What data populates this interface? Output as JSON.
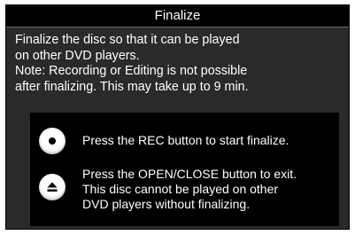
{
  "dialog": {
    "title": "Finalize",
    "description_lines": [
      "Finalize the disc so that it can be played",
      "on other DVD players.",
      "Note: Recording or Editing is not possible",
      "after finalizing. This may take up to 9 min."
    ]
  },
  "instructions": [
    {
      "icon": "rec-button-icon",
      "lines": [
        "Press the REC button to start finalize."
      ]
    },
    {
      "icon": "eject-button-icon",
      "lines": [
        "Press the OPEN/CLOSE button to exit.",
        "This disc cannot be played on other",
        "DVD players without finalizing."
      ]
    }
  ],
  "colors": {
    "dialog_background": "#2a2a2a",
    "title_background": "#000000",
    "panel_background": "#000000",
    "text": "#ffffff"
  }
}
